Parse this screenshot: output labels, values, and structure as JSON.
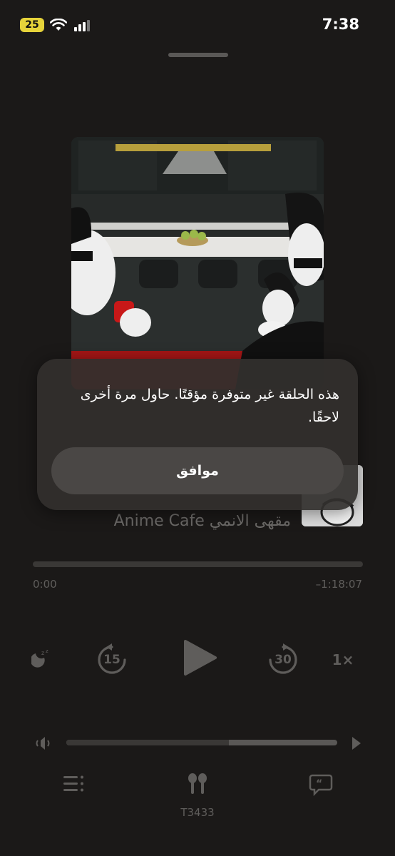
{
  "status_bar": {
    "battery": "25",
    "time": "7:38"
  },
  "player": {
    "podcast_title": "مقهى الانمي Anime Cafe",
    "time_elapsed": "0:00",
    "time_remaining": "–1:18:07",
    "skip_back_seconds": "15",
    "skip_forward_seconds": "30",
    "playback_speed": "1×",
    "progress": 0,
    "volume": 0.6
  },
  "bottom_bar": {
    "airplay_label": "T3433"
  },
  "alert": {
    "message": "هذه الحلقة غير متوفرة مؤقتًا. حاول مرة أخرى لاحقًا.",
    "ok_label": "موافق"
  }
}
